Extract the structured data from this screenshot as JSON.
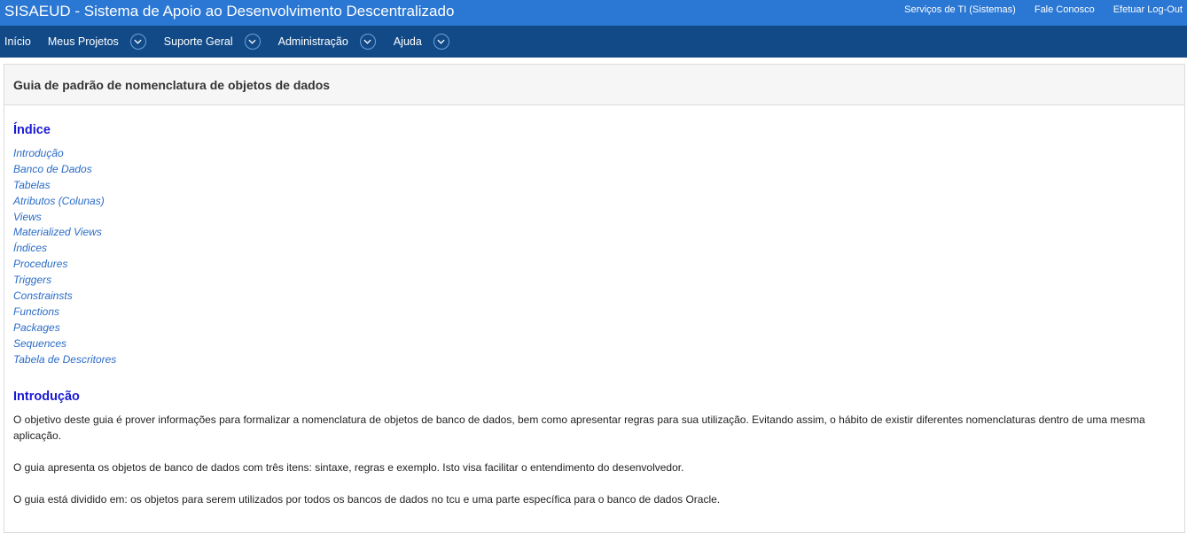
{
  "header": {
    "app_title": "SISAEUD - Sistema de Apoio ao Desenvolvimento Descentralizado",
    "links": [
      "Serviços de TI (Sistemas)",
      "Fale Conosco",
      "Efetuar Log-Out"
    ]
  },
  "nav": {
    "items": [
      {
        "label": "Início",
        "has_dropdown": false
      },
      {
        "label": "Meus Projetos",
        "has_dropdown": true
      },
      {
        "label": "Suporte Geral",
        "has_dropdown": true
      },
      {
        "label": "Administração",
        "has_dropdown": true
      },
      {
        "label": "Ajuda",
        "has_dropdown": true
      }
    ]
  },
  "page": {
    "title": "Guia de padrão de nomenclatura de objetos de dados",
    "index_heading": "Índice",
    "index_items": [
      "Introdução",
      "Banco de Dados",
      "Tabelas",
      "Atributos (Colunas)",
      "Views",
      "Materialized Views",
      "Índices",
      "Procedures",
      "Triggers",
      "Constrainsts",
      "Functions",
      "Packages",
      "Sequences",
      "Tabela de Descritores"
    ],
    "intro_heading": "Introdução",
    "intro_paragraphs": [
      "O objetivo deste guia é prover informações para formalizar a nomenclatura de objetos de banco de dados, bem como apresentar regras para sua utilização. Evitando assim, o hábito de existir diferentes nomenclaturas dentro de uma mesma aplicação.",
      "O guia apresenta os objetos de banco de dados com três itens: sintaxe, regras e exemplo. Isto visa facilitar o entendimento do desenvolvedor.",
      "O guia está dividido em: os objetos para serem utilizados por todos os bancos de dados no tcu e uma parte específica para o banco de dados Oracle."
    ]
  },
  "colors": {
    "topbar": "#2a77d4",
    "navbar": "#124a87",
    "heading": "#1a1ad6",
    "link": "#2a6cc7"
  }
}
